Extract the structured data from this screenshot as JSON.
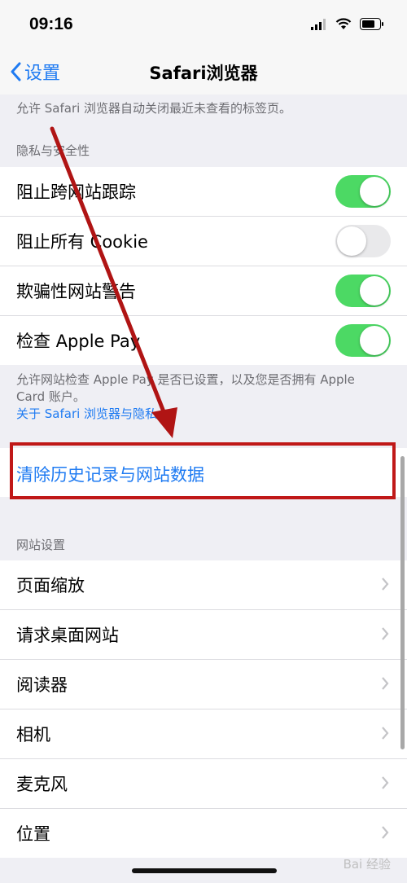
{
  "status": {
    "time": "09:16"
  },
  "nav": {
    "back_label": "设置",
    "title": "Safari浏览器"
  },
  "top_note": "允许 Safari 浏览器自动关闭最近未查看的标签页。",
  "privacy": {
    "header": "隐私与安全性",
    "rows": [
      {
        "label": "阻止跨网站跟踪",
        "on": true
      },
      {
        "label": "阻止所有 Cookie",
        "on": false
      },
      {
        "label": "欺骗性网站警告",
        "on": true
      },
      {
        "label": "检查 Apple Pay",
        "on": true
      }
    ],
    "footnote": "允许网站检查 Apple Pay 是否已设置，以及您是否拥有 Apple Card 账户。",
    "footnote_link": "关于 Safari 浏览器与隐私..."
  },
  "clear": {
    "label": "清除历史记录与网站数据"
  },
  "website": {
    "header": "网站设置",
    "rows": [
      {
        "label": "页面缩放"
      },
      {
        "label": "请求桌面网站"
      },
      {
        "label": "阅读器"
      },
      {
        "label": "相机"
      },
      {
        "label": "麦克风"
      },
      {
        "label": "位置"
      }
    ]
  },
  "watermark": "Bai 经验",
  "colors": {
    "accent": "#1f7bf2",
    "toggle_on": "#4cd964",
    "annotation": "#c01818"
  }
}
